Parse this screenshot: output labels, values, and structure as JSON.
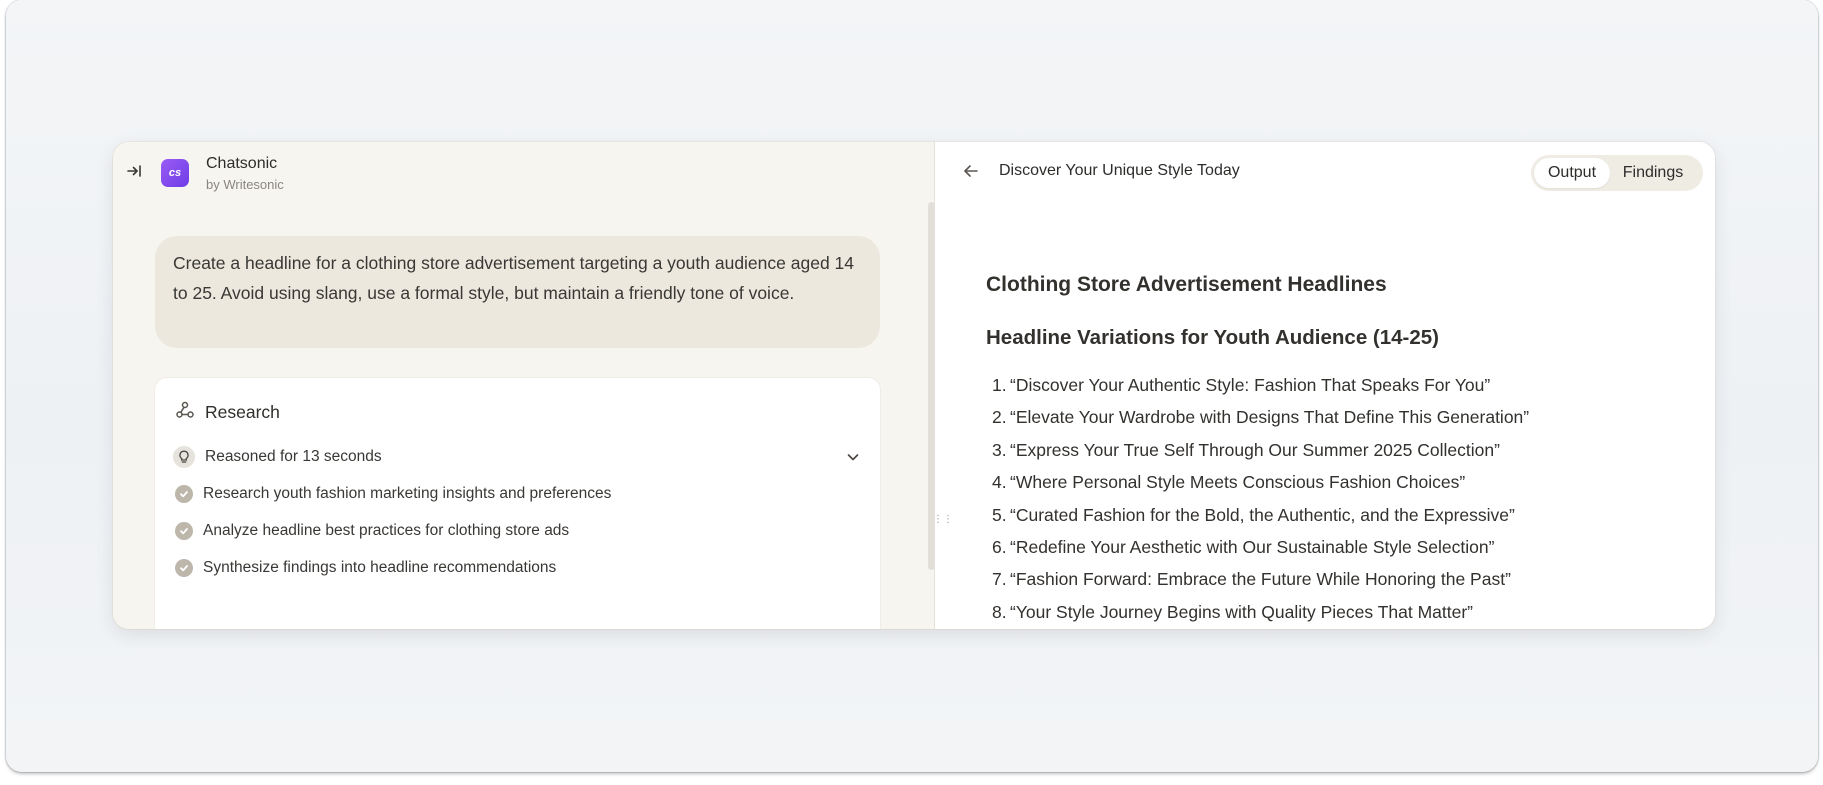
{
  "app": {
    "name": "Chatsonic",
    "byline": "by Writesonic",
    "logo_text": "cs",
    "brand_color": "#7c4dff"
  },
  "chat": {
    "prompt": "Create a headline for a clothing store advertisement targeting a youth audience aged 14 to 25. Avoid using slang, use a formal style, but maintain a friendly tone of voice."
  },
  "research": {
    "title": "Research",
    "reasoned_label": "Reasoned for 13 seconds",
    "steps": [
      "Research youth fashion marketing insights and preferences",
      "Analyze headline best practices for clothing store ads",
      "Synthesize findings into headline recommendations"
    ]
  },
  "document": {
    "title": "Discover Your Unique Style Today",
    "tabs": {
      "output": "Output",
      "findings": "Findings",
      "active": "Output"
    },
    "heading1": "Clothing Store Advertisement Headlines",
    "heading2": "Headline Variations for Youth Audience (14-25)",
    "headlines": [
      "“Discover Your Authentic Style: Fashion That Speaks For You”",
      "“Elevate Your Wardrobe with Designs That Define This Generation”",
      "“Express Your True Self Through Our Summer 2025 Collection”",
      "“Where Personal Style Meets Conscious Fashion Choices”",
      "“Curated Fashion for the Bold, the Authentic, and the Expressive”",
      "“Redefine Your Aesthetic with Our Sustainable Style Selection”",
      "“Fashion Forward: Embrace the Future While Honoring the Past”",
      "“Your Style Journey Begins with Quality Pieces That Matter”"
    ]
  },
  "icons": {
    "collapse": "collapse-sidebar-icon",
    "research": "research-icon",
    "bulb": "lightbulb-icon",
    "expand": "chevron-down-icon",
    "step_done": "check-circle-icon",
    "back": "arrow-left-icon",
    "resize": "drag-handle-icon"
  }
}
